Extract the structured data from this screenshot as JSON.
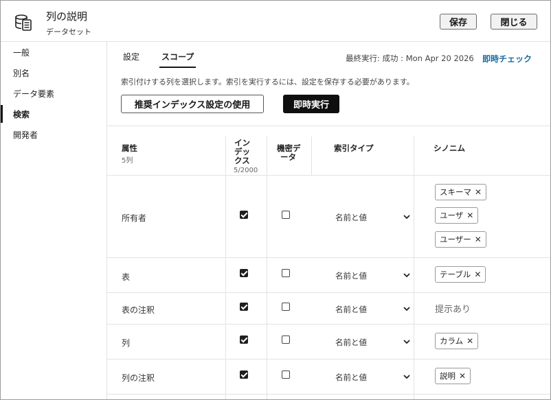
{
  "header": {
    "title": "列の説明",
    "subtitle": "データセット",
    "save_label": "保存",
    "close_label": "閉じる"
  },
  "sidebar": {
    "items": [
      {
        "label": "一般",
        "active": false
      },
      {
        "label": "別名",
        "active": false
      },
      {
        "label": "データ要素",
        "active": false
      },
      {
        "label": "検索",
        "active": true
      },
      {
        "label": "開発者",
        "active": false
      }
    ]
  },
  "tabs": [
    {
      "label": "設定",
      "active": false
    },
    {
      "label": "スコープ",
      "active": true
    }
  ],
  "status": {
    "last_run": "最終実行: 成功 : Mon Apr 20 2026",
    "instant_check": "即時チェック"
  },
  "description": "索引付けする列を選択します。索引を実行するには、設定を保存する必要があります。",
  "buttons": {
    "recommended": "推奨インデックス設定の使用",
    "run_now": "即時実行"
  },
  "table": {
    "headers": {
      "attribute": "属性",
      "attribute_sub": "5列",
      "index_l1": "イン",
      "index_l2": "デッ",
      "index_l3": "クス",
      "index_sub": "5/2000",
      "sensitive_l1": "機密デ",
      "sensitive_l2": "ータ",
      "index_type": "索引タイプ",
      "synonyms": "シノニム"
    },
    "rows": [
      {
        "name": "所有者",
        "indexed": true,
        "sensitive": false,
        "index_type": "名前と値",
        "synonyms": [
          "スキーマ",
          "ユーザ",
          "ユーザー"
        ],
        "placeholder": ""
      },
      {
        "name": "表",
        "indexed": true,
        "sensitive": false,
        "index_type": "名前と値",
        "synonyms": [
          "テーブル"
        ],
        "placeholder": ""
      },
      {
        "name": "表の注釈",
        "indexed": true,
        "sensitive": false,
        "index_type": "名前と値",
        "synonyms": [],
        "placeholder": "提示あり"
      },
      {
        "name": "列",
        "indexed": true,
        "sensitive": false,
        "index_type": "名前と値",
        "synonyms": [
          "カラム"
        ],
        "placeholder": ""
      },
      {
        "name": "列の注釈",
        "indexed": true,
        "sensitive": false,
        "index_type": "名前と値",
        "synonyms": [
          "説明"
        ],
        "placeholder": ""
      }
    ]
  },
  "icons": {
    "app": "dataset-icon",
    "chevron": "chevron-down-icon",
    "remove": "close-icon"
  },
  "colors": {
    "accent_link": "#1b6aa0",
    "primary_button": "#0f0f0f"
  }
}
